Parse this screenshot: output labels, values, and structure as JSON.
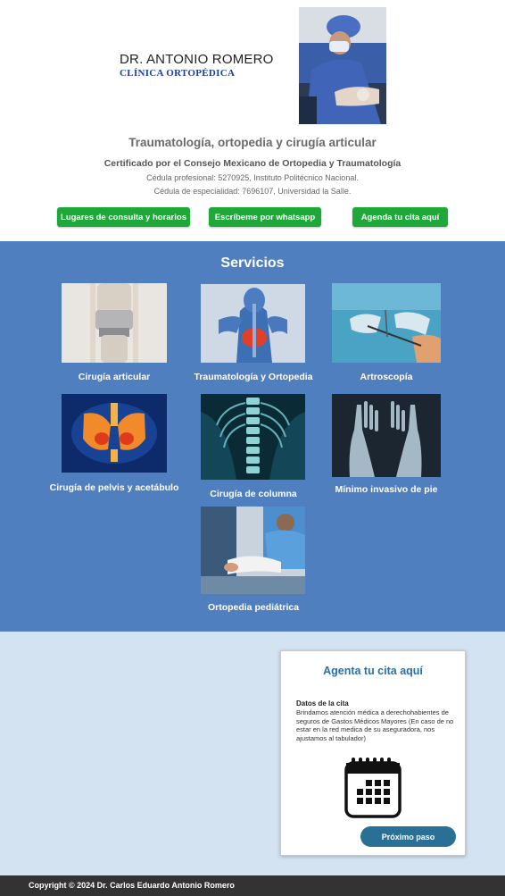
{
  "header": {
    "doctor_name": "DR. ANTONIO ROMERO",
    "clinic_name": "CLÍNICA ORTOPÉDICA",
    "specialty": "Traumatología, ortopedia y cirugía articular",
    "certification": "Certificado por el Consejo Mexicano de Ortopedia y Traumatología",
    "cedula_profesional": "Cédula profesional: 5270925, Instituto Politécnico Nacional.",
    "cedula_especialidad": "Cédula de especialidad: 7696107, Universidad la Salle.",
    "buttons": {
      "locations": "Lugares de consulta y horarios",
      "whatsapp": "Escríbeme por whatsapp",
      "appointment": "Agenda tu cita aquí"
    }
  },
  "services": {
    "title": "Servicios",
    "items": [
      {
        "label": "Cirugía articular"
      },
      {
        "label": "Traumatología y Ortopedia"
      },
      {
        "label": "Artroscopía"
      },
      {
        "label": "Cirugía de pelvis y acetábulo"
      },
      {
        "label": "Cirugía de columna"
      },
      {
        "label": "Mínimo invasivo de pie"
      },
      {
        "label": "Ortopedia pediátrica"
      }
    ]
  },
  "appointment": {
    "title": "Agenta tu cita aquí",
    "subtitle": "Datos de la cita",
    "text": "Brindamos atención médica a derechohabientes de seguros de Gastos Médicos Mayores  (En caso de no estar en la red medica de su aseguradora, nos ajustamos al tabulador)",
    "next_button": "Próximo paso"
  },
  "footer": {
    "copyright": "Copyright © 2024 Dr. Carlos Eduardo Antonio Romero"
  },
  "colors": {
    "green_button": "#1fa83a",
    "services_bg": "#4f7fbe",
    "appointment_bg": "#d3e3f1",
    "footer_bg": "#333333",
    "accent_blue": "#2a6fa8"
  }
}
